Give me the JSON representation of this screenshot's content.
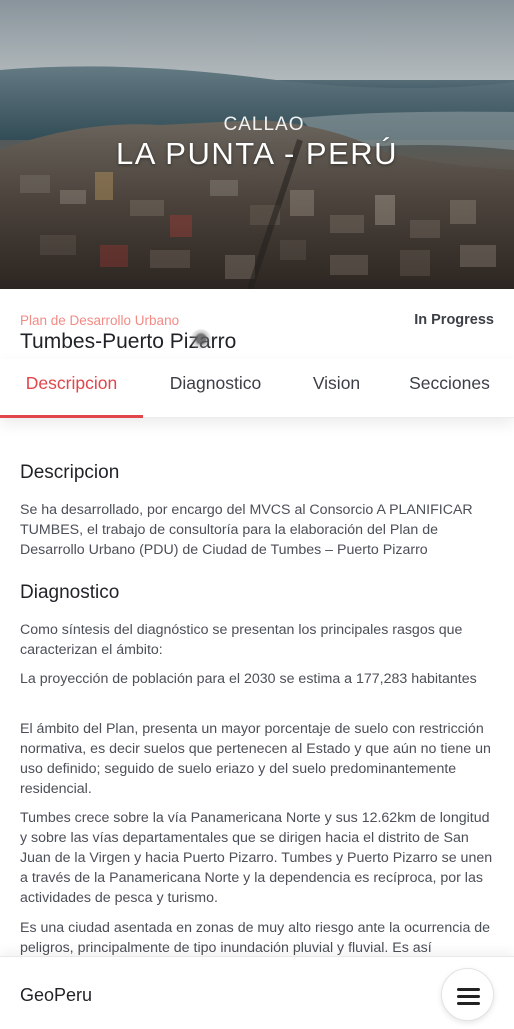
{
  "hero": {
    "subtitle": "CALLAO",
    "title": "LA PUNTA - PERÚ"
  },
  "project": {
    "category": "Plan de Desarrollo Urbano",
    "status": "In Progress",
    "title": "Tumbes-Puerto Pizarro"
  },
  "tabs": [
    {
      "label": "Descripcion",
      "active": true
    },
    {
      "label": "Diagnostico",
      "active": false
    },
    {
      "label": "Vision",
      "active": false
    },
    {
      "label": "Secciones",
      "active": false
    }
  ],
  "sections": {
    "descripcion": {
      "heading": "Descripcion",
      "text": "Se ha desarrollado, por encargo del MVCS al Consorcio A PLANIFICAR TUMBES, el trabajo de consultoría para la elaboración del Plan de Desarrollo Urbano (PDU) de Ciudad de Tumbes – Puerto Pizarro"
    },
    "diagnostico": {
      "heading": "Diagnostico",
      "paragraphs": [
        "Como síntesis del diagnóstico se presentan los principales rasgos que caracterizan el ámbito:",
        "La proyección de población para el 2030 se estima a 177,283 habitantes",
        "El ámbito del Plan, presenta un mayor porcentaje de suelo con restricción normativa, es decir suelos que pertenecen al Estado y que aún no tiene un uso definido; seguido de suelo eriazo y del suelo predominantemente residencial.",
        "Tumbes crece sobre la vía Panamericana Norte y sus 12.62km de longitud y sobre las vías departamentales que se dirigen hacia el distrito de San Juan de la Virgen y hacia Puerto Pizarro. Tumbes y Puerto Pizarro se unen a través de la Panamericana Norte y la dependencia es recíproca, por las actividades de pesca y turismo.",
        "Es una ciudad asentada en zonas de muy alto riesgo ante la ocurrencia de peligros, principalmente de tipo inundación pluvial y fluvial. Es así"
      ]
    }
  },
  "footer": {
    "brand": "GeoPeru",
    "menu_icon": "hamburger-menu-icon"
  },
  "colors": {
    "accent": "#e0464a",
    "category": "#f28b86",
    "text": "#4b4f57",
    "heading": "#1f2227"
  }
}
